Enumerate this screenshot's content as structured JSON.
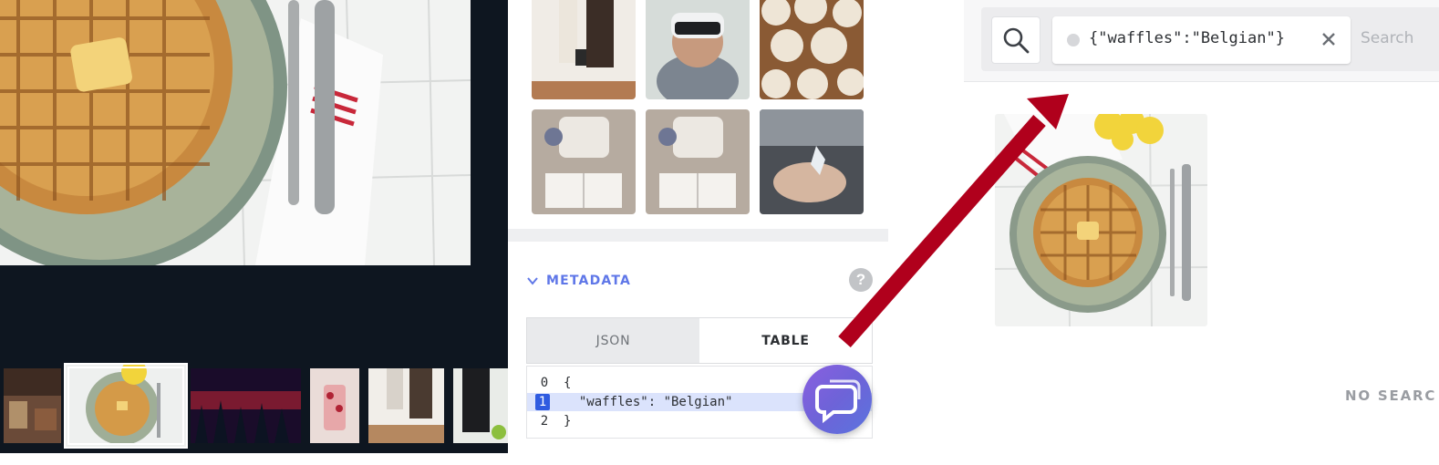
{
  "viewer": {
    "main_image_icon": "waffle-photo",
    "filmstrip": [
      {
        "icon": "living-room-photo",
        "selected": false
      },
      {
        "icon": "waffle-photo",
        "selected": true
      },
      {
        "icon": "red-night-forest-photo",
        "selected": false
      },
      {
        "icon": "cake-photo",
        "selected": false
      },
      {
        "icon": "clothing-rack-photo",
        "selected": false
      },
      {
        "icon": "coat-photo",
        "selected": false
      }
    ]
  },
  "gallery": {
    "tiles": [
      {
        "icon": "coat-hanger-photo"
      },
      {
        "icon": "vr-headset-boy-photo"
      },
      {
        "icon": "white-pumpkins-photo"
      },
      {
        "icon": "cozy-book-photo"
      },
      {
        "icon": "cozy-book-photo"
      },
      {
        "icon": "hand-crystal-photo"
      }
    ]
  },
  "metadata": {
    "title": "METADATA",
    "help_label": "?",
    "tabs": [
      {
        "label": "JSON",
        "active": false
      },
      {
        "label": "TABLE",
        "active": true
      }
    ],
    "code_lines": [
      {
        "num": "0",
        "text": "{",
        "highlighted": false
      },
      {
        "num": "1",
        "text": "  \"waffles\": \"Belgian\"",
        "highlighted": true
      },
      {
        "num": "2",
        "text": "}",
        "highlighted": false
      }
    ]
  },
  "search": {
    "query": "{\"waffles\":\"Belgian\"}",
    "button_label": "Search",
    "no_results_text": "NO SEARC",
    "result_icon": "waffle-photo"
  },
  "colors": {
    "accent": "#5f77e8",
    "dark_bg": "#0e1620",
    "highlight": "#2f5be0",
    "arrow": "#b0001c"
  }
}
